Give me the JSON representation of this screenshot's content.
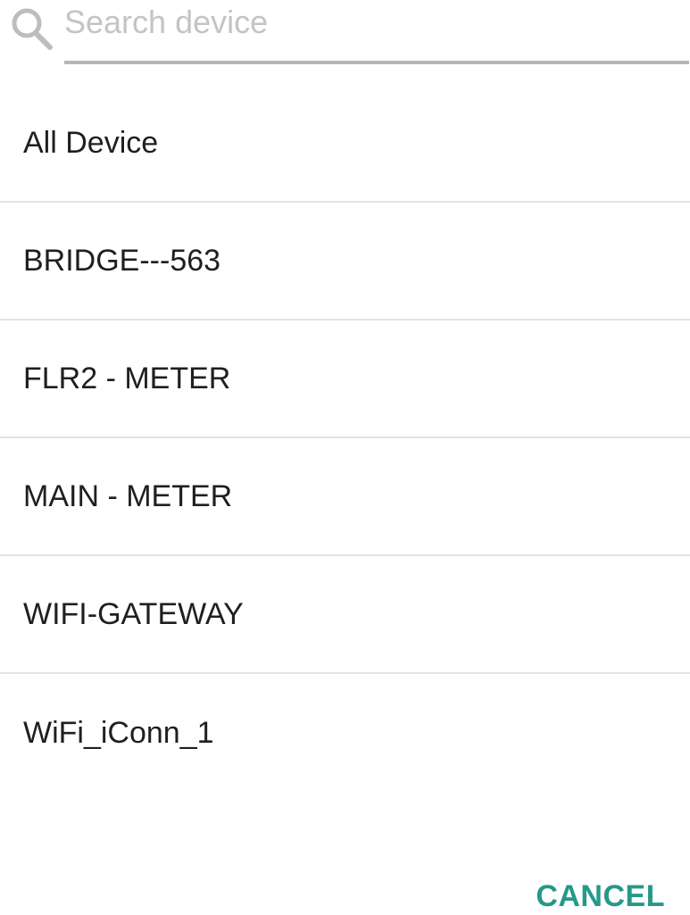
{
  "search": {
    "placeholder": "Search device",
    "value": "",
    "icon": "search-icon",
    "underline_color": "#b7b7b7"
  },
  "devices": [
    {
      "label": "All Device"
    },
    {
      "label": "BRIDGE---563"
    },
    {
      "label": "FLR2 - METER"
    },
    {
      "label": "MAIN - METER"
    },
    {
      "label": "WIFI-GATEWAY"
    },
    {
      "label": "WiFi_iConn_1"
    }
  ],
  "actions": {
    "cancel_label": "CANCEL"
  },
  "colors": {
    "accent": "#26988a",
    "text": "#1f1f1f",
    "placeholder": "#c4c4c4",
    "divider": "#e4e4e4"
  }
}
